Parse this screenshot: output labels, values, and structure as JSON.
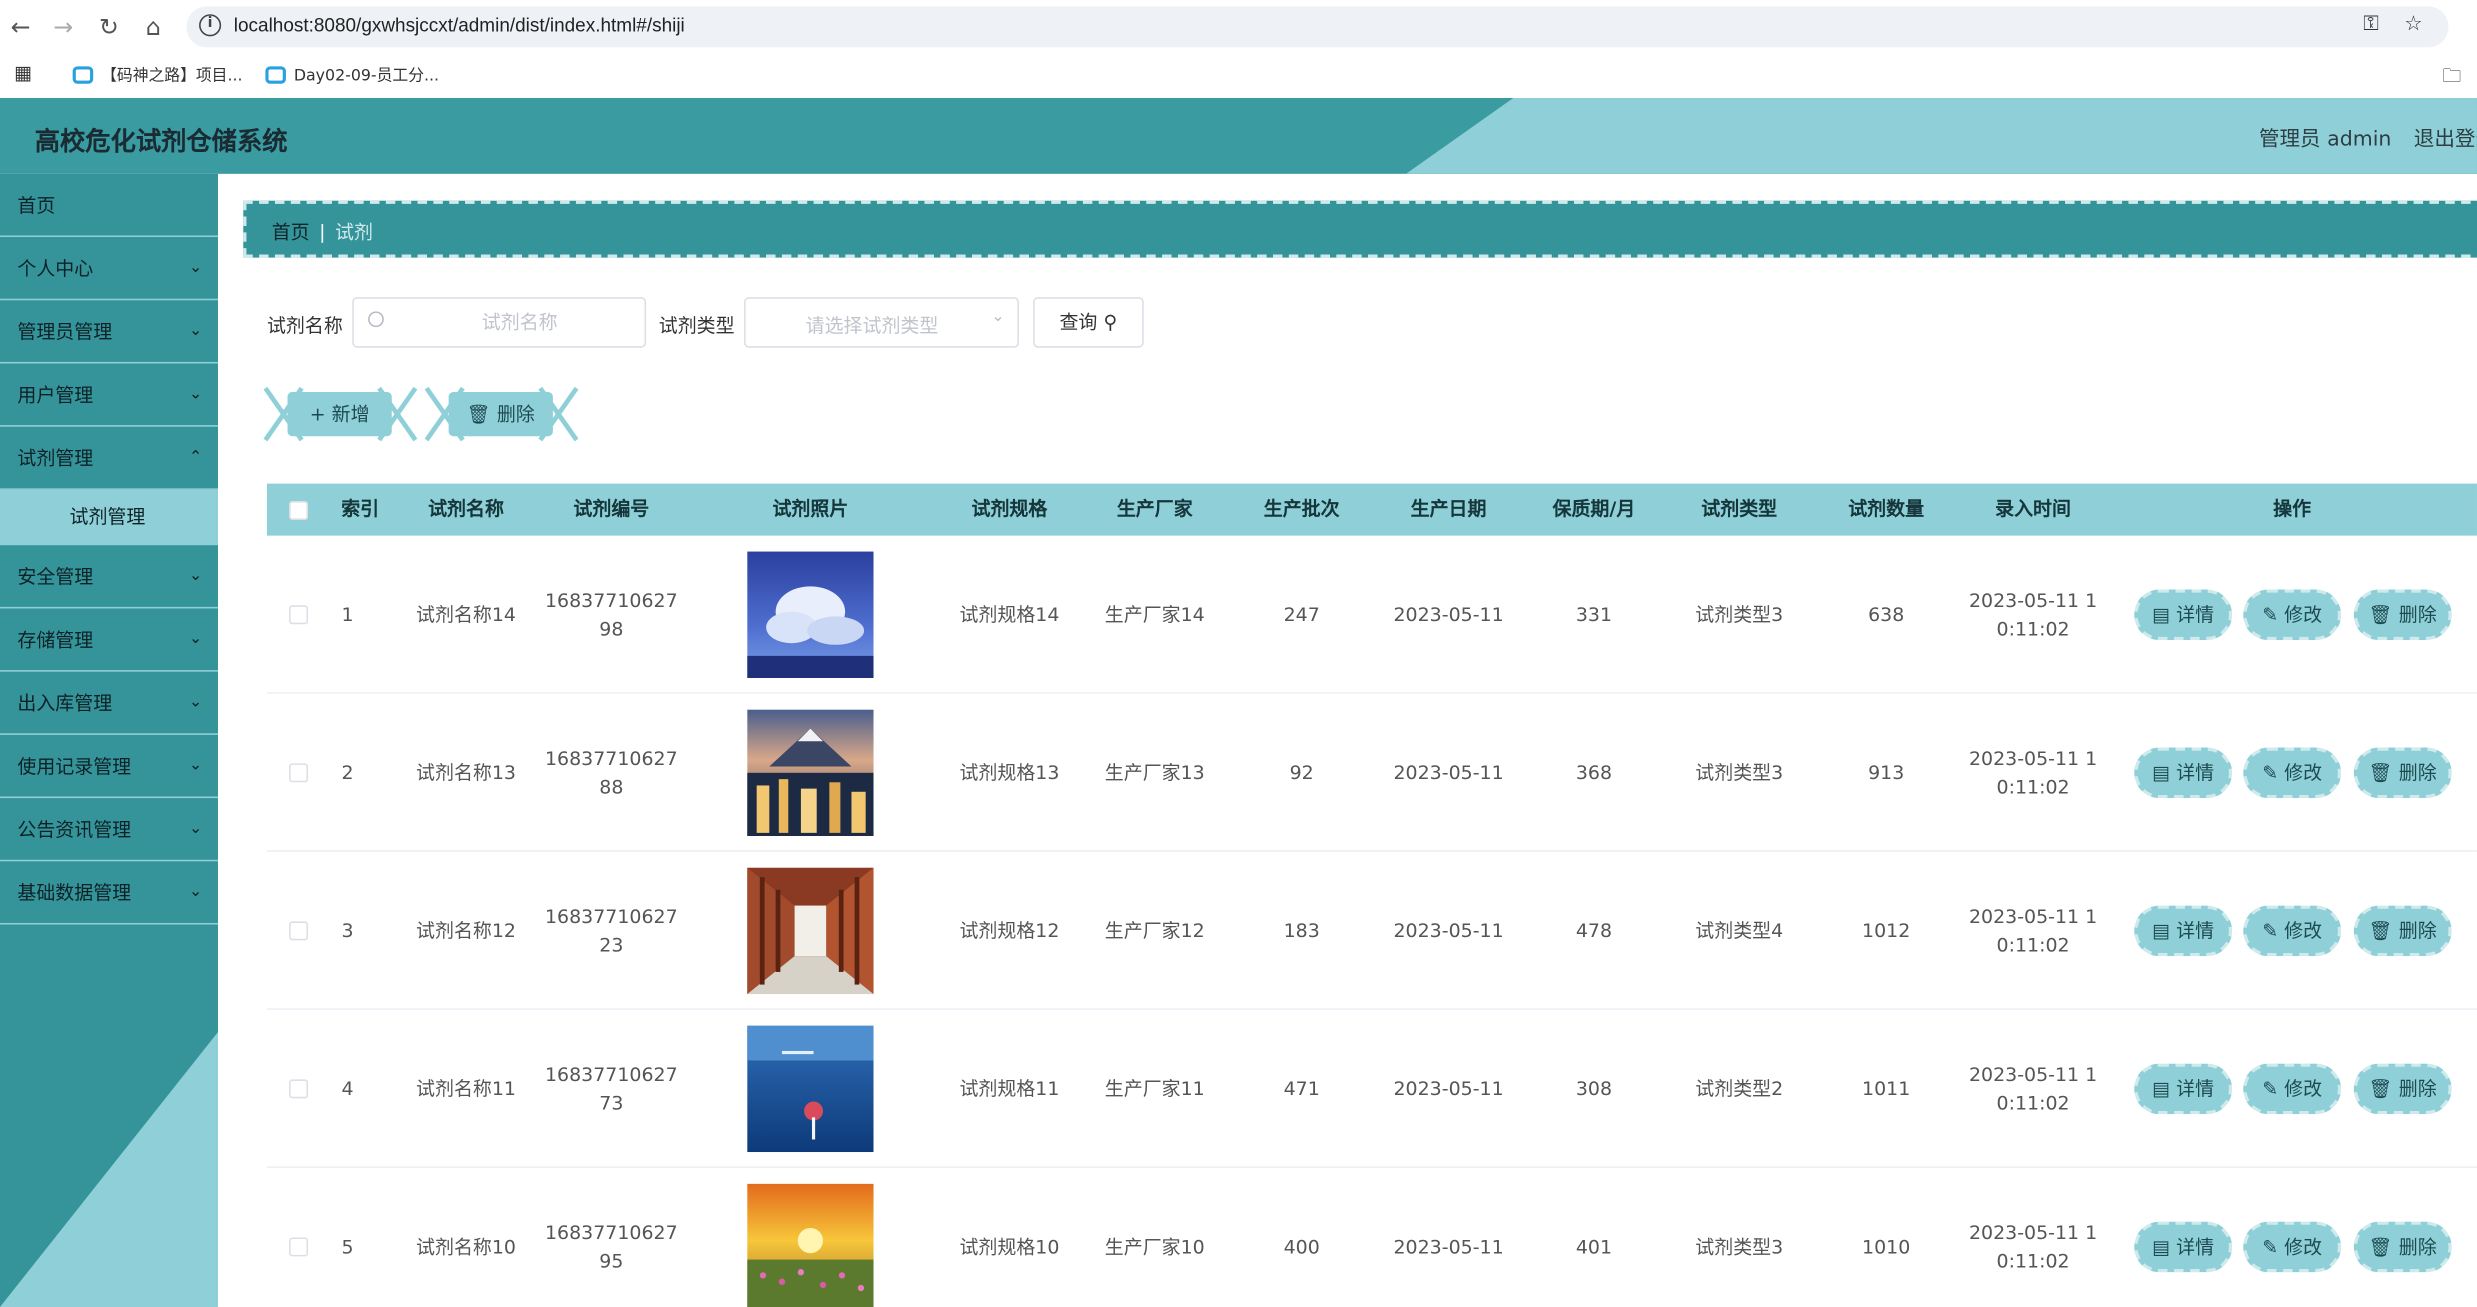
{
  "browser": {
    "url": "localhost:8080/gxwhsjccxt/admin/dist/index.html#/shiji",
    "bookmarks": [
      "【码神之路】项目...",
      "Day02-09-员工分..."
    ]
  },
  "header": {
    "title": "高校危化试剂仓储系统",
    "user": "管理员 admin",
    "logout": "退出登录"
  },
  "sidebar": {
    "items": [
      {
        "label": "首页"
      },
      {
        "label": "个人中心"
      },
      {
        "label": "管理员管理"
      },
      {
        "label": "用户管理"
      },
      {
        "label": "试剂管理"
      },
      {
        "label": "试剂管理"
      },
      {
        "label": "安全管理"
      },
      {
        "label": "存储管理"
      },
      {
        "label": "出入库管理"
      },
      {
        "label": "使用记录管理"
      },
      {
        "label": "公告资讯管理"
      },
      {
        "label": "基础数据管理"
      }
    ]
  },
  "breadcrumb": {
    "home": "首页",
    "separator": "|",
    "current": "试剂"
  },
  "search": {
    "name_label": "试剂名称",
    "name_placeholder": "试剂名称",
    "type_label": "试剂类型",
    "type_placeholder": "请选择试剂类型",
    "query_button": "查询"
  },
  "actions": {
    "add": "新增",
    "delete": "删除"
  },
  "table": {
    "headers": [
      "索引",
      "试剂名称",
      "试剂编号",
      "试剂照片",
      "试剂规格",
      "生产厂家",
      "生产批次",
      "生产日期",
      "保质期/月",
      "试剂类型",
      "试剂数量",
      "录入时间",
      "操作"
    ],
    "op_labels": {
      "detail": "详情",
      "edit": "修改",
      "delete": "删除"
    },
    "rows": [
      {
        "index": "1",
        "name": "试剂名称14",
        "code1": "16837710627",
        "code2": "98",
        "spec": "试剂规格14",
        "maker": "生产厂家14",
        "batch": "247",
        "date": "2023-05-11",
        "shelf": "331",
        "type": "试剂类型3",
        "qty": "638",
        "time1": "2023-05-11 1",
        "time2": "0:11:02",
        "photo": "sky-clouds"
      },
      {
        "index": "2",
        "name": "试剂名称13",
        "code1": "16837710627",
        "code2": "88",
        "spec": "试剂规格13",
        "maker": "生产厂家13",
        "batch": "92",
        "date": "2023-05-11",
        "shelf": "368",
        "type": "试剂类型3",
        "qty": "913",
        "time1": "2023-05-11 1",
        "time2": "0:11:02",
        "photo": "city-mountain"
      },
      {
        "index": "3",
        "name": "试剂名称12",
        "code1": "16837710627",
        "code2": "23",
        "spec": "试剂规格12",
        "maker": "生产厂家12",
        "batch": "183",
        "date": "2023-05-11",
        "shelf": "478",
        "type": "试剂类型4",
        "qty": "1012",
        "time1": "2023-05-11 1",
        "time2": "0:11:02",
        "photo": "corridor"
      },
      {
        "index": "4",
        "name": "试剂名称11",
        "code1": "16837710627",
        "code2": "73",
        "spec": "试剂规格11",
        "maker": "生产厂家11",
        "batch": "471",
        "date": "2023-05-11",
        "shelf": "308",
        "type": "试剂类型2",
        "qty": "1011",
        "time1": "2023-05-11 1",
        "time2": "0:11:02",
        "photo": "sea-umbrella"
      },
      {
        "index": "5",
        "name": "试剂名称10",
        "code1": "16837710627",
        "code2": "95",
        "spec": "试剂规格10",
        "maker": "生产厂家10",
        "batch": "400",
        "date": "2023-05-11",
        "shelf": "401",
        "type": "试剂类型3",
        "qty": "1010",
        "time1": "2023-05-11 1",
        "time2": "0:11:02",
        "photo": "sunset-meadow"
      }
    ]
  },
  "colors": {
    "primary": "#35939a",
    "accent": "#8fd0d8"
  }
}
